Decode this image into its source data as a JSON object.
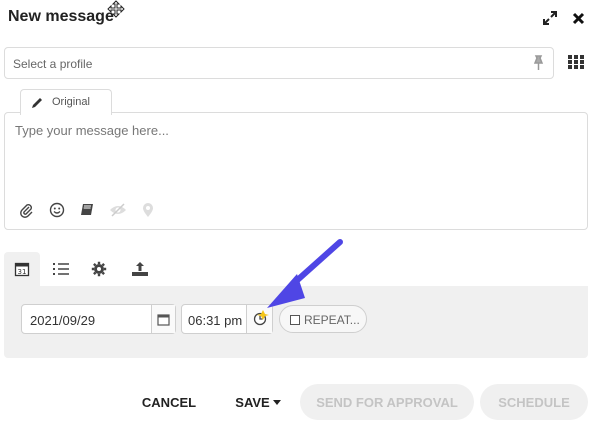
{
  "dialog": {
    "title": "New message"
  },
  "profile": {
    "placeholder": "Select a profile"
  },
  "editor": {
    "tab_label": "Original",
    "placeholder": "Type your message here..."
  },
  "schedule": {
    "date_value": "2021/09/29",
    "time_value": "06:31 pm",
    "repeat_label": "REPEAT..."
  },
  "footer": {
    "cancel_label": "CANCEL",
    "save_label": "SAVE",
    "approval_label": "SEND FOR APPROVAL",
    "schedule_label": "SCHEDULE"
  },
  "annotation": {
    "arrow_color": "#4f46e5"
  },
  "icons": [
    "move-cursor-icon",
    "expand-icon",
    "close-icon",
    "pin-icon",
    "grid-icon",
    "pencil-icon",
    "paperclip-icon",
    "emoji-icon",
    "book-icon",
    "eye-slash-icon",
    "location-icon",
    "calendar-icon",
    "list-icon",
    "gear-icon",
    "upload-icon",
    "clock-icon"
  ]
}
